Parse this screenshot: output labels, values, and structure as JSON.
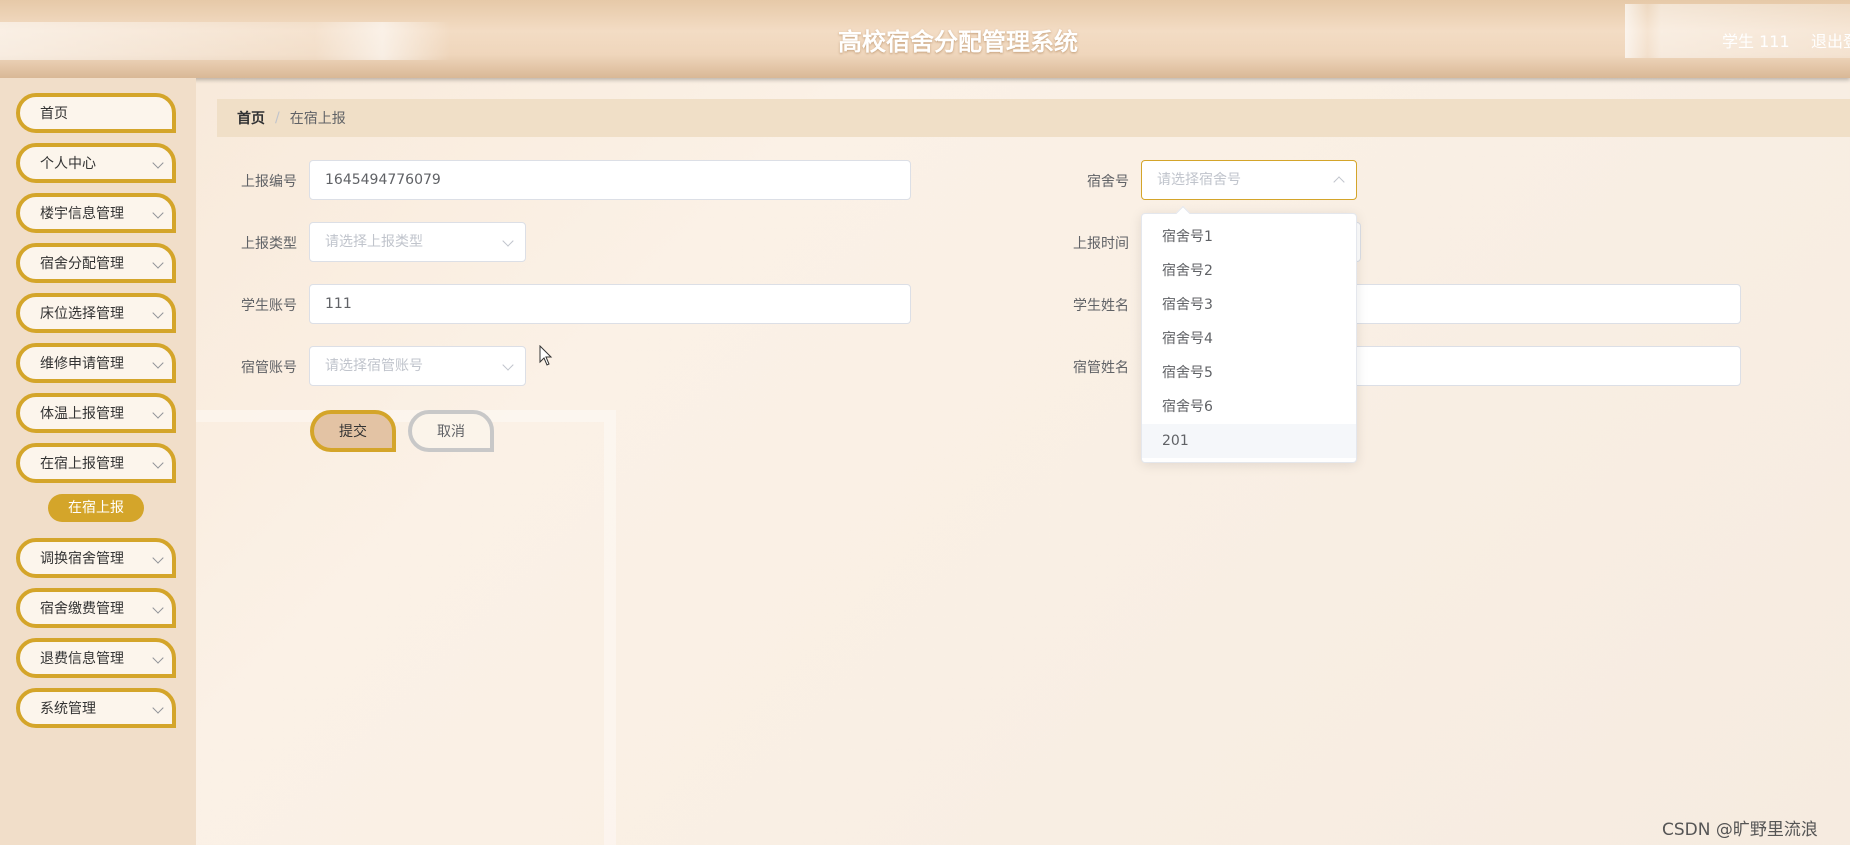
{
  "header": {
    "title": "高校宿舍分配管理系统",
    "user": "学生 111",
    "logout": "退出登录"
  },
  "sidebar": {
    "items": [
      {
        "label": "首页"
      },
      {
        "label": "个人中心"
      },
      {
        "label": "楼宇信息管理"
      },
      {
        "label": "宿舍分配管理"
      },
      {
        "label": "床位选择管理"
      },
      {
        "label": "维修申请管理"
      },
      {
        "label": "体温上报管理"
      },
      {
        "label": "在宿上报管理"
      },
      {
        "label": "调换宿舍管理"
      },
      {
        "label": "宿舍缴费管理"
      },
      {
        "label": "退费信息管理"
      },
      {
        "label": "系统管理"
      }
    ],
    "active_sub": "在宿上报"
  },
  "breadcrumb": {
    "home": "首页",
    "separator": "/",
    "current": "在宿上报"
  },
  "form": {
    "report_no_label": "上报编号",
    "report_no_value": "1645494776079",
    "dorm_no_label": "宿舍号",
    "dorm_no_placeholder": "请选择宿舍号",
    "report_type_label": "上报类型",
    "report_type_placeholder": "请选择上报类型",
    "report_time_label": "上报时间",
    "student_account_label": "学生账号",
    "student_account_value": "111",
    "student_name_label": "学生姓名",
    "manager_account_label": "宿管账号",
    "manager_account_placeholder": "请选择宿管账号",
    "manager_name_label": "宿管姓名",
    "submit_label": "提交",
    "cancel_label": "取消"
  },
  "dropdown": {
    "options": [
      "宿舍号1",
      "宿舍号2",
      "宿舍号3",
      "宿舍号4",
      "宿舍号5",
      "宿舍号6",
      "201"
    ],
    "hovered": "201"
  },
  "watermark": "CSDN @旷野里流浪",
  "colors": {
    "accent": "#d4a52a",
    "header": "#efd6bc",
    "sidebar": "#f1dec9"
  }
}
